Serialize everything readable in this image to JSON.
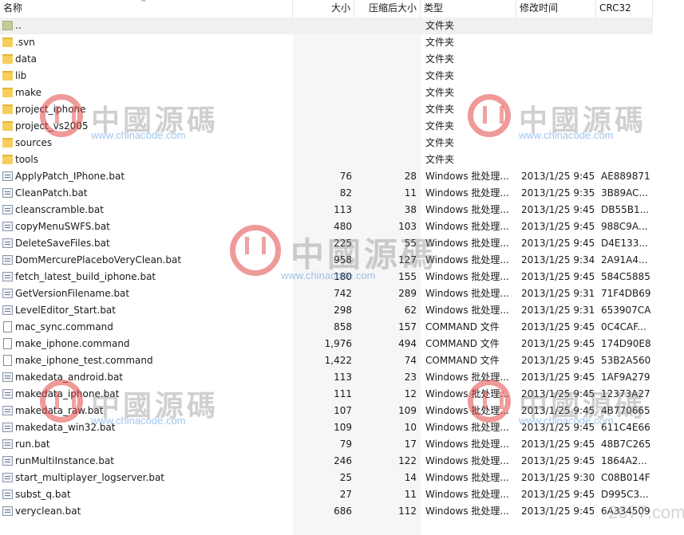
{
  "columns": {
    "name": "名称",
    "size": "大小",
    "packed": "压缩后大小",
    "type": "类型",
    "modified": "修改时间",
    "crc": "CRC32"
  },
  "rows": [
    {
      "icon": "parent-folder-icon",
      "name": "..",
      "size": "",
      "packed": "",
      "type": "文件夹",
      "modified": "",
      "crc": ""
    },
    {
      "icon": "folder-icon",
      "name": ".svn",
      "size": "",
      "packed": "",
      "type": "文件夹",
      "modified": "",
      "crc": ""
    },
    {
      "icon": "folder-icon",
      "name": "data",
      "size": "",
      "packed": "",
      "type": "文件夹",
      "modified": "",
      "crc": ""
    },
    {
      "icon": "folder-icon",
      "name": "lib",
      "size": "",
      "packed": "",
      "type": "文件夹",
      "modified": "",
      "crc": ""
    },
    {
      "icon": "folder-icon",
      "name": "make",
      "size": "",
      "packed": "",
      "type": "文件夹",
      "modified": "",
      "crc": ""
    },
    {
      "icon": "folder-icon",
      "name": "project_iphone",
      "size": "",
      "packed": "",
      "type": "文件夹",
      "modified": "",
      "crc": ""
    },
    {
      "icon": "folder-icon",
      "name": "project_vs2005",
      "size": "",
      "packed": "",
      "type": "文件夹",
      "modified": "",
      "crc": ""
    },
    {
      "icon": "folder-icon",
      "name": "sources",
      "size": "",
      "packed": "",
      "type": "文件夹",
      "modified": "",
      "crc": ""
    },
    {
      "icon": "folder-icon",
      "name": "tools",
      "size": "",
      "packed": "",
      "type": "文件夹",
      "modified": "",
      "crc": ""
    },
    {
      "icon": "batch-file-icon",
      "name": "ApplyPatch_IPhone.bat",
      "size": "76",
      "packed": "28",
      "type": "Windows 批处理...",
      "modified": "2013/1/25 9:45",
      "crc": "AE889871"
    },
    {
      "icon": "batch-file-icon",
      "name": "CleanPatch.bat",
      "size": "82",
      "packed": "11",
      "type": "Windows 批处理...",
      "modified": "2013/1/25 9:35",
      "crc": "3B89AC..."
    },
    {
      "icon": "batch-file-icon",
      "name": "cleanscramble.bat",
      "size": "113",
      "packed": "38",
      "type": "Windows 批处理...",
      "modified": "2013/1/25 9:45",
      "crc": "DB55B1..."
    },
    {
      "icon": "batch-file-icon",
      "name": "copyMenuSWFS.bat",
      "size": "480",
      "packed": "103",
      "type": "Windows 批处理...",
      "modified": "2013/1/25 9:45",
      "crc": "988C9A..."
    },
    {
      "icon": "batch-file-icon",
      "name": "DeleteSaveFiles.bat",
      "size": "225",
      "packed": "55",
      "type": "Windows 批处理...",
      "modified": "2013/1/25 9:45",
      "crc": "D4E133..."
    },
    {
      "icon": "batch-file-icon",
      "name": "DomMercurePlaceboVeryClean.bat",
      "size": "958",
      "packed": "127",
      "type": "Windows 批处理...",
      "modified": "2013/1/25 9:34",
      "crc": "2A91A4..."
    },
    {
      "icon": "batch-file-icon",
      "name": "fetch_latest_build_iphone.bat",
      "size": "180",
      "packed": "155",
      "type": "Windows 批处理...",
      "modified": "2013/1/25 9:45",
      "crc": "584C5885"
    },
    {
      "icon": "batch-file-icon",
      "name": "GetVersionFilename.bat",
      "size": "742",
      "packed": "289",
      "type": "Windows 批处理...",
      "modified": "2013/1/25 9:31",
      "crc": "71F4DB69"
    },
    {
      "icon": "batch-file-icon",
      "name": "LevelEditor_Start.bat",
      "size": "298",
      "packed": "62",
      "type": "Windows 批处理...",
      "modified": "2013/1/25 9:31",
      "crc": "653907CA"
    },
    {
      "icon": "file-icon",
      "name": "mac_sync.command",
      "size": "858",
      "packed": "157",
      "type": "COMMAND 文件",
      "modified": "2013/1/25 9:45",
      "crc": "0C4CAF..."
    },
    {
      "icon": "file-icon",
      "name": "make_iphone.command",
      "size": "1,976",
      "packed": "494",
      "type": "COMMAND 文件",
      "modified": "2013/1/25 9:45",
      "crc": "174D90E8"
    },
    {
      "icon": "file-icon",
      "name": "make_iphone_test.command",
      "size": "1,422",
      "packed": "74",
      "type": "COMMAND 文件",
      "modified": "2013/1/25 9:45",
      "crc": "53B2A560"
    },
    {
      "icon": "batch-file-icon",
      "name": "makedata_android.bat",
      "size": "113",
      "packed": "23",
      "type": "Windows 批处理...",
      "modified": "2013/1/25 9:45",
      "crc": "1AF9A279"
    },
    {
      "icon": "batch-file-icon",
      "name": "makedata_iphone.bat",
      "size": "111",
      "packed": "12",
      "type": "Windows 批处理...",
      "modified": "2013/1/25 9:45",
      "crc": "12373A27"
    },
    {
      "icon": "batch-file-icon",
      "name": "makedata_raw.bat",
      "size": "107",
      "packed": "109",
      "type": "Windows 批处理...",
      "modified": "2013/1/25 9:45",
      "crc": "4B770665"
    },
    {
      "icon": "batch-file-icon",
      "name": "makedata_win32.bat",
      "size": "109",
      "packed": "10",
      "type": "Windows 批处理...",
      "modified": "2013/1/25 9:45",
      "crc": "611C4E66"
    },
    {
      "icon": "batch-file-icon",
      "name": "run.bat",
      "size": "79",
      "packed": "17",
      "type": "Windows 批处理...",
      "modified": "2013/1/25 9:45",
      "crc": "48B7C265"
    },
    {
      "icon": "batch-file-icon",
      "name": "runMultiInstance.bat",
      "size": "246",
      "packed": "122",
      "type": "Windows 批处理...",
      "modified": "2013/1/25 9:45",
      "crc": "1864A2..."
    },
    {
      "icon": "batch-file-icon",
      "name": "start_multiplayer_logserver.bat",
      "size": "25",
      "packed": "14",
      "type": "Windows 批处理...",
      "modified": "2013/1/25 9:30",
      "crc": "C08B014F"
    },
    {
      "icon": "batch-file-icon",
      "name": "subst_q.bat",
      "size": "27",
      "packed": "11",
      "type": "Windows 批处理...",
      "modified": "2013/1/25 9:45",
      "crc": "D995C3..."
    },
    {
      "icon": "batch-file-icon",
      "name": "veryclean.bat",
      "size": "686",
      "packed": "112",
      "type": "Windows 批处理...",
      "modified": "2013/1/25 9:45",
      "crc": "6A334509"
    }
  ],
  "watermarks": {
    "cn_text": "中國源碼",
    "url": "www.chinacode.com",
    "corner": "2677.com"
  },
  "colors": {
    "folder": "#f7ce5b",
    "selected_row": "#f0f0f0",
    "watermark_red": "#e14646",
    "watermark_blue": "#5096dc"
  }
}
